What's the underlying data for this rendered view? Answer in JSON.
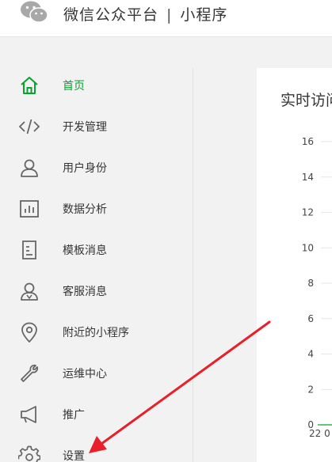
{
  "header": {
    "title_left": "微信公众平台",
    "separator": "|",
    "title_right": "小程序"
  },
  "sidebar": {
    "items": [
      {
        "label": "首页",
        "icon": "home-icon",
        "active": true
      },
      {
        "label": "开发管理",
        "icon": "code-icon",
        "active": false
      },
      {
        "label": "用户身份",
        "icon": "user-icon",
        "active": false
      },
      {
        "label": "数据分析",
        "icon": "bar-chart-icon",
        "active": false
      },
      {
        "label": "模板消息",
        "icon": "document-icon",
        "active": false
      },
      {
        "label": "客服消息",
        "icon": "customer-service-icon",
        "active": false
      },
      {
        "label": "附近的小程序",
        "icon": "location-pin-icon",
        "active": false
      },
      {
        "label": "运维中心",
        "icon": "wrench-icon",
        "active": false
      },
      {
        "label": "推广",
        "icon": "megaphone-icon",
        "active": false
      },
      {
        "label": "设置",
        "icon": "gear-icon",
        "active": false
      }
    ]
  },
  "main": {
    "card_title": "实时访问"
  },
  "chart_data": {
    "type": "line",
    "title": "实时访问",
    "y_ticks": [
      "16",
      "14",
      "12",
      "10",
      "8",
      "6",
      "4",
      "2",
      "0"
    ],
    "ylim": [
      0,
      16
    ],
    "x_tick_partial": "22 0",
    "grid": true
  },
  "colors": {
    "accent": "#07a32e",
    "annotation_arrow": "#e8202a"
  }
}
